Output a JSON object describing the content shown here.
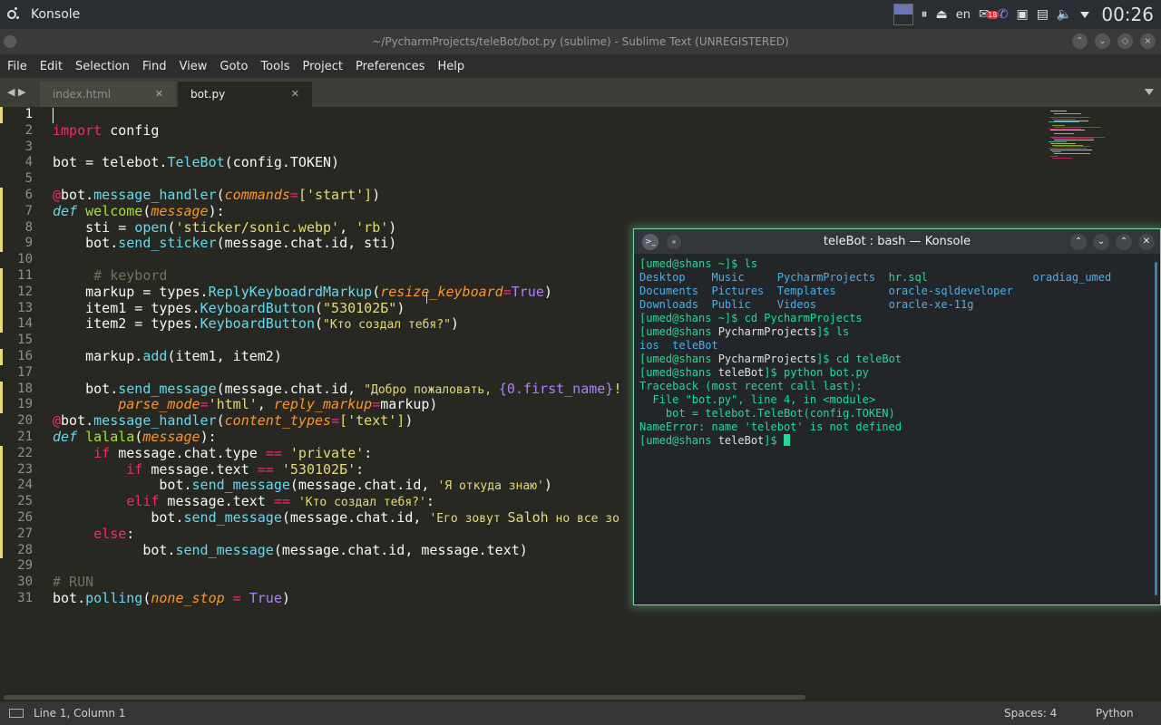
{
  "panel": {
    "app_title": "Konsole",
    "keyboard_layout": "en",
    "notification_count": "18",
    "clock": "00:26"
  },
  "sublime": {
    "window_title": "~/PycharmProjects/teleBot/bot.py (sublime) - Sublime Text (UNREGISTERED)",
    "menu": [
      "File",
      "Edit",
      "Selection",
      "Find",
      "View",
      "Goto",
      "Tools",
      "Project",
      "Preferences",
      "Help"
    ],
    "tabs": [
      {
        "label": "index.html",
        "active": false
      },
      {
        "label": "bot.py",
        "active": true
      }
    ],
    "status": {
      "position": "Line 1, Column 1",
      "spaces": "Spaces: 4",
      "syntax": "Python"
    },
    "code": {
      "l2_kw": "import",
      "l2_rest": " config",
      "l4_a": "bot = telebot.",
      "l4_b": "TeleBot",
      "l4_c": "(config.TOKEN)",
      "l6_a": "@",
      "l6_b": "bot.",
      "l6_c": "message_handler",
      "l6_d": "(",
      "l6_e": "commands",
      "l6_f": "=",
      "l6_g": "['start']",
      "l6_h": ")",
      "l7_a": "def",
      "l7_b": " ",
      "l7_c": "welcome",
      "l7_d": "(",
      "l7_e": "message",
      "l7_f": "):",
      "l8_a": "    sti = ",
      "l8_b": "open",
      "l8_c": "(",
      "l8_d": "'sticker/sonic.webp'",
      "l8_e": ", ",
      "l8_f": "'rb'",
      "l8_g": ")",
      "l9_a": "    bot.",
      "l9_b": "send_sticker",
      "l9_c": "(message.chat.id, sti)",
      "l11_a": "     ",
      "l11_b": "# keybord",
      "l12_a": "    markup = types.",
      "l12_b": "ReplyKeyboadrdMarkup",
      "l12_c": "(",
      "l12_d": "resize_keyboard",
      "l12_e": "=",
      "l12_f": "True",
      "l12_g": ")",
      "l13_a": "    item1 = types.",
      "l13_b": "KeyboardButton",
      "l13_c": "(",
      "l13_d": "\"530102Б\"",
      "l13_e": ")",
      "l14_a": "    item2 = types.",
      "l14_b": "KeyboardButton",
      "l14_c": "(",
      "l14_d": "\"Кто создал тебя?\"",
      "l14_e": ")",
      "l16_a": "    markup.",
      "l16_b": "add",
      "l16_c": "(item1, item2)",
      "l18_a": "    bot.",
      "l18_b": "send_message",
      "l18_c": "(message.chat.id, ",
      "l18_d": "\"Добро пожаловать, ",
      "l18_e": "{0.first_name}",
      "l18_f": "!",
      "l19_a": "        ",
      "l19_b": "parse_mode",
      "l19_c": "=",
      "l19_d": "'html'",
      "l19_e": ", ",
      "l19_f": "reply_markup",
      "l19_g": "=",
      "l19_h": "markup)",
      "l20_a": "@",
      "l20_b": "bot.",
      "l20_c": "message_handler",
      "l20_d": "(",
      "l20_e": "content_types",
      "l20_f": "=",
      "l20_g": "['text']",
      "l20_h": ")",
      "l21_a": "def",
      "l21_b": " ",
      "l21_c": "lalala",
      "l21_d": "(",
      "l21_e": "message",
      "l21_f": "):",
      "l22_a": "     ",
      "l22_b": "if",
      "l22_c": " message.chat.type ",
      "l22_d": "==",
      "l22_e": " ",
      "l22_f": "'private'",
      "l22_g": ":",
      "l23_a": "         ",
      "l23_b": "if",
      "l23_c": " message.text ",
      "l23_d": "==",
      "l23_e": " ",
      "l23_f": "'530102Б'",
      "l23_g": ":",
      "l24_a": "             bot.",
      "l24_b": "send_message",
      "l24_c": "(message.chat.id, ",
      "l24_d": "'Я откуда знаю'",
      "l24_e": ")",
      "l25_a": "         ",
      "l25_b": "elif",
      "l25_c": " message.text ",
      "l25_d": "==",
      "l25_e": " ",
      "l25_f": "'Кто создал тебя?'",
      "l25_g": ":",
      "l26_a": "            bot.",
      "l26_b": "send_message",
      "l26_c": "(message.chat.id, ",
      "l26_d": "'Его зовут ",
      "l26_e": "Saloh",
      "l26_f": " но все зо",
      "l27_a": "     ",
      "l27_b": "else",
      "l27_c": ":",
      "l28_a": "           bot.",
      "l28_b": "send_message",
      "l28_c": "(message.chat.id, message.text)",
      "l30_a": "# RUN",
      "l31_a": "bot.",
      "l31_b": "polling",
      "l31_c": "(",
      "l31_d": "none_stop",
      "l31_e": " = ",
      "l31_f": "True",
      "l31_g": ")"
    }
  },
  "konsole": {
    "title": "teleBot : bash — Konsole",
    "lines": {
      "t1_p": "[umed@shans ~]$ ",
      "t1_c": "ls",
      "t2_a": "Desktop    ",
      "t2_b": "Music     ",
      "t2_c": "PycharmProjects  ",
      "t2_d": "hr.sql",
      "t2_e": "                ",
      "t2_f": "oradiag_umed",
      "t3_a": "Documents  ",
      "t3_b": "Pictures  ",
      "t3_c": "Templates        ",
      "t3_d": "oracle-sqldeveloper",
      "t4_a": "Downloads  ",
      "t4_b": "Public    ",
      "t4_c": "Videos           ",
      "t4_d": "oracle-xe-11g",
      "t5_p": "[umed@shans ~]$ ",
      "t5_c": "cd PycharmProjects",
      "t6_p1": "[umed@shans ",
      "t6_d": "PycharmProjects",
      "t6_p2": "]$ ",
      "t6_c": "ls",
      "t7_a": "ios",
      "t7_b": "  ",
      "t7_c": "teleBot",
      "t8_p1": "[umed@shans ",
      "t8_d": "PycharmProjects",
      "t8_p2": "]$ ",
      "t8_c": "cd teleBot",
      "t9_p1": "[umed@shans ",
      "t9_d": "teleBot",
      "t9_p2": "]$ ",
      "t9_c": "python bot.py",
      "t10": "Traceback (most recent call last):",
      "t11": "  File \"bot.py\", line 4, in <module>",
      "t12": "    bot = telebot.TeleBot(config.TOKEN)",
      "t13": "NameError: name 'telebot' is not defined",
      "t14_p1": "[umed@shans ",
      "t14_d": "teleBot",
      "t14_p2": "]$ "
    }
  },
  "colors": {
    "editor_bg": "#272822",
    "keyword": "#f92672",
    "function": "#66d9ef",
    "string": "#e6db74",
    "param": "#fd971f",
    "terminal_green": "#1cdc9a",
    "terminal_blue": "#4ab0e8",
    "focus_glow": "#7ad3a4"
  }
}
